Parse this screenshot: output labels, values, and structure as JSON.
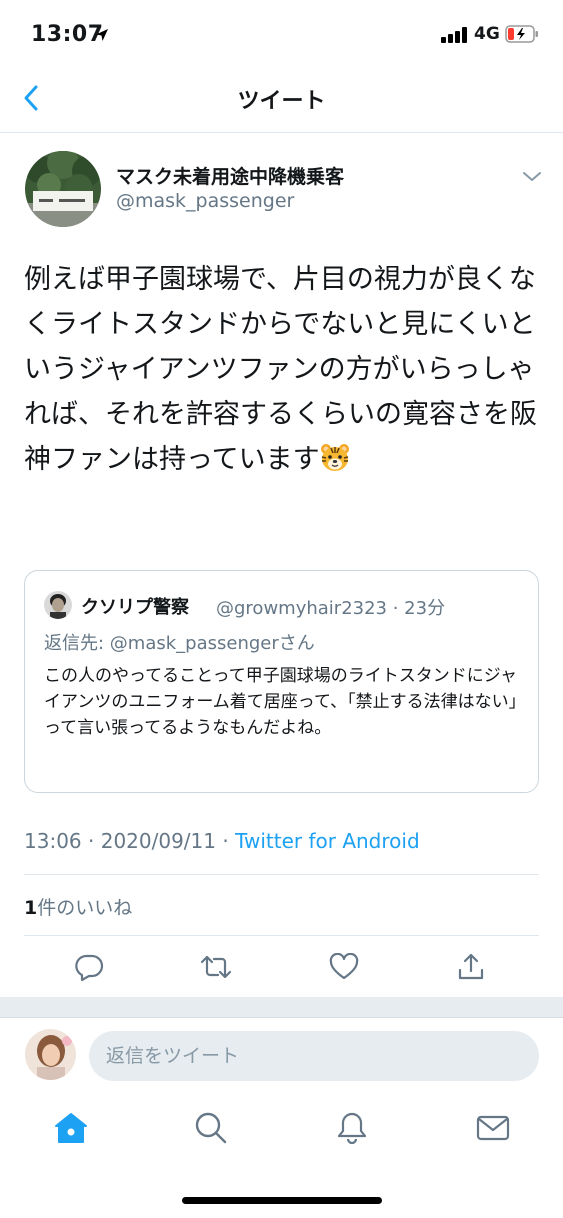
{
  "status_bar": {
    "time": "13:07",
    "network": "4G"
  },
  "nav": {
    "title": "ツイート"
  },
  "tweet": {
    "display_name": "マスク未着用途中降機乗客",
    "handle": "@mask_passenger",
    "text": "例えば甲子園球場で、片目の視力が良くなくライトスタンドからでないと見にくいというジャイアンツファンの方がいらっしゃれば、それを許容するくらいの寛容さを阪神ファンは持っています",
    "emoji": "tiger-face-icon",
    "time": "13:06",
    "date": "2020/09/11",
    "source": "Twitter for Android",
    "likes_count": "1",
    "likes_label": "件のいいね"
  },
  "quote": {
    "display_name": "クソリプ警察",
    "handle": "@growmyhair2323",
    "age": "23分",
    "reply_prefix": "返信先: ",
    "reply_to": "@mask_passenger",
    "reply_suffix": "さん",
    "text": "この人のやってることって甲子園球場のライトスタンドにジャイアンツのユニフォーム着て居座って、「禁止する法律はない」って言い張ってるようなもんだよね。"
  },
  "composer": {
    "placeholder": "返信をツイート"
  },
  "colors": {
    "accent": "#1da1f2",
    "secondary_text": "#657786",
    "divider": "#e1e8ed",
    "battery_low": "#ff3b30"
  }
}
